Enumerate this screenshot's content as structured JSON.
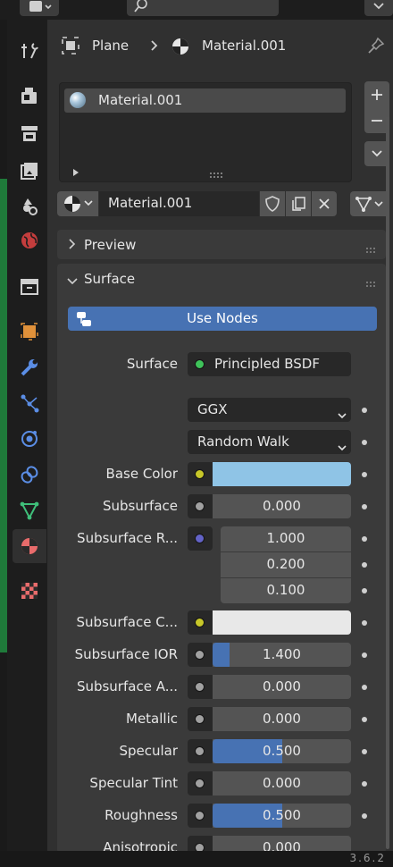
{
  "header": {
    "object_name": "Plane",
    "material_name": "Material.001"
  },
  "slot_list": {
    "items": [
      {
        "label": "Material.001"
      }
    ],
    "add_icon": "plus-icon",
    "remove_icon": "minus-icon"
  },
  "datablock": {
    "name": "Material.001"
  },
  "panels": {
    "preview_label": "Preview",
    "surface_label": "Surface"
  },
  "use_nodes_label": "Use Nodes",
  "surface": {
    "label": "Surface",
    "shader": "Principled BSDF",
    "distribution": "GGX",
    "subsurface_method": "Random Walk"
  },
  "properties": [
    {
      "label": "Base Color",
      "kind": "color",
      "socket_color": "#c7c729",
      "swatch": "#8fc4e6"
    },
    {
      "label": "Subsurface",
      "kind": "value",
      "value": "0.000",
      "fill": 0,
      "socket_color": "#a1a1a1"
    },
    {
      "label": "Subsurface R...",
      "kind": "vector",
      "values": [
        "1.000",
        "0.200",
        "0.100"
      ],
      "socket_color": "#6363c7"
    },
    {
      "label": "Subsurface C...",
      "kind": "color",
      "socket_color": "#c7c729",
      "swatch": "#e8e8e8"
    },
    {
      "label": "Subsurface IOR",
      "kind": "value",
      "value": "1.400",
      "fill": 0.12,
      "socket_color": "#a1a1a1"
    },
    {
      "label": "Subsurface A...",
      "kind": "value",
      "value": "0.000",
      "fill": 0,
      "socket_color": "#a1a1a1"
    },
    {
      "label": "Metallic",
      "kind": "value",
      "value": "0.000",
      "fill": 0,
      "socket_color": "#a1a1a1"
    },
    {
      "label": "Specular",
      "kind": "value",
      "value": "0.500",
      "fill": 0.5,
      "socket_color": "#a1a1a1"
    },
    {
      "label": "Specular Tint",
      "kind": "value",
      "value": "0.000",
      "fill": 0,
      "socket_color": "#a1a1a1"
    },
    {
      "label": "Roughness",
      "kind": "value",
      "value": "0.500",
      "fill": 0.5,
      "socket_color": "#a1a1a1"
    },
    {
      "label": "Anisotropic",
      "kind": "value",
      "value": "0.000",
      "fill": 0,
      "socket_color": "#a1a1a1"
    }
  ],
  "status": {
    "version": "3.6.2"
  },
  "tabs": [
    "tool-icon",
    "render-icon",
    "output-icon",
    "view-layer-icon",
    "scene-icon",
    "world-icon",
    "collection-icon",
    "object-icon",
    "modifier-icon",
    "particles-icon",
    "physics-icon",
    "constraints-icon",
    "object-data-icon",
    "material-icon",
    "texture-icon"
  ],
  "colors": {
    "accent": "#4772b3",
    "panel": "#3a3a3a",
    "field": "#545454",
    "background": "#303030"
  }
}
